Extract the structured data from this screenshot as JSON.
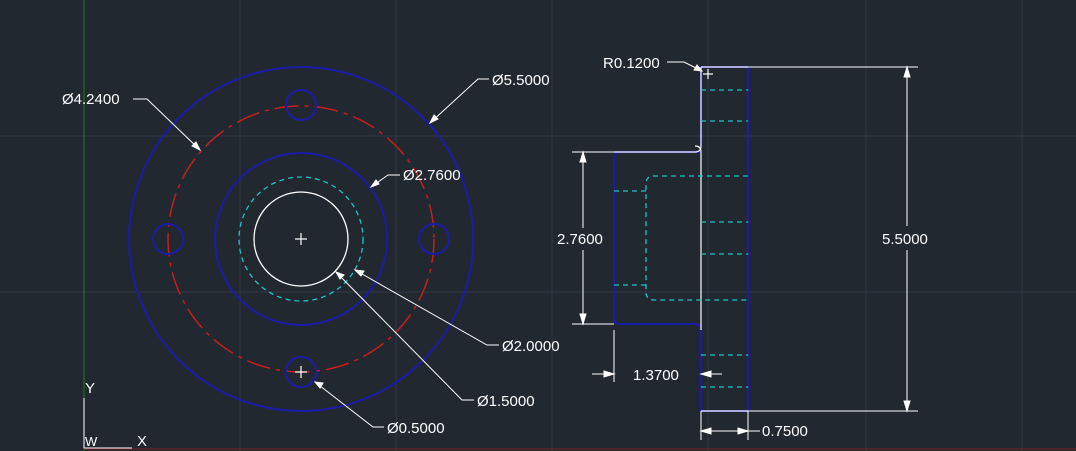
{
  "colors": {
    "background": "#212830",
    "grid": "#2f3a46",
    "outline": "#1b1ba8",
    "bolt_circle": "#c81e1e",
    "hidden": "#1fc4c4",
    "annotation": "#ffffff",
    "y_axis": "#1f7a2a",
    "x_axis": "#7a1f1f"
  },
  "front_view": {
    "dim_outer_diameter": "Ø5.5000",
    "dim_bolt_circle": "Ø4.2400",
    "dim_hub_diameter": "Ø2.7600",
    "dim_counterbore": "Ø2.0000",
    "dim_bore": "Ø1.5000",
    "dim_bolt_hole": "Ø0.5000"
  },
  "side_view": {
    "dim_fillet_radius": "R0.1200",
    "dim_hub_height": "2.7600",
    "dim_overall_height": "5.5000",
    "dim_hub_length": "1.3700",
    "dim_flange_thickness": "0.7500"
  },
  "ucs_icon": {
    "y_label": "Y",
    "x_label": "X",
    "w_label": "W"
  }
}
